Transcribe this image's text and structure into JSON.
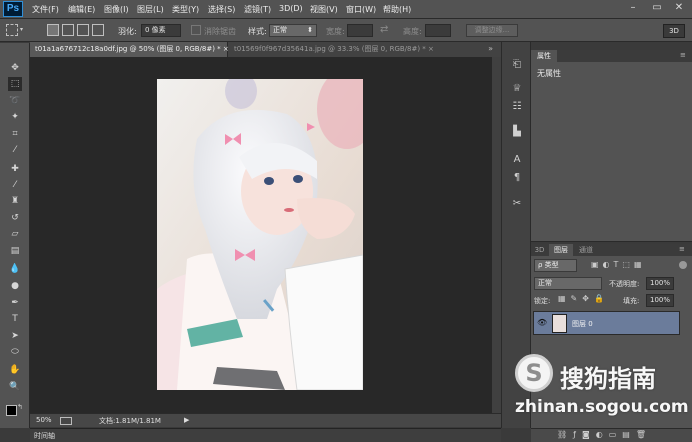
{
  "app": {
    "logo": "Ps"
  },
  "menu": [
    "文件(F)",
    "编辑(E)",
    "图像(I)",
    "图层(L)",
    "类型(Y)",
    "选择(S)",
    "滤镜(T)",
    "3D(D)",
    "视图(V)",
    "窗口(W)",
    "帮助(H)"
  ],
  "window_controls": {
    "minimize": "–",
    "restore": "▭",
    "close": "✕"
  },
  "options": {
    "feather_label": "羽化:",
    "feather_value": "0 像素",
    "antialias_label": "消除锯齿",
    "style_label": "样式:",
    "style_value": "正常",
    "width_label": "宽度:",
    "height_label": "高度:",
    "refine_edge": "调整边缘...",
    "threed": "3D"
  },
  "tabs": [
    {
      "label": "t01a1a676712c18a0df.jpg @ 50% (图层 0, RGB/8#) * ×"
    },
    {
      "label": "t01569f0f967d35641a.jpg @ 33.3% (图层 0, RGB/8#) * ×"
    }
  ],
  "status": {
    "zoom": "50%",
    "doc": "文档:1.81M/1.81M"
  },
  "timeline": {
    "label": "时间轴"
  },
  "properties": {
    "tab": "属性",
    "empty": "无属性"
  },
  "layers": {
    "tabs": [
      "3D",
      "图层",
      "通道"
    ],
    "filter": "ρ 类型",
    "blend_mode": "正常",
    "opacity_label": "不透明度:",
    "opacity_value": "100%",
    "lock_label": "锁定:",
    "fill_label": "填充:",
    "fill_value": "100%",
    "items": [
      {
        "name": "图层 0",
        "visible": true
      }
    ]
  },
  "watermark": {
    "title": "搜狗指南",
    "url": "zhinan.sogou.com"
  },
  "colors": {
    "accent": "#47a8f5",
    "selected_layer": "#6b7c9b",
    "panel": "#535353",
    "canvas_bg": "#282828"
  }
}
